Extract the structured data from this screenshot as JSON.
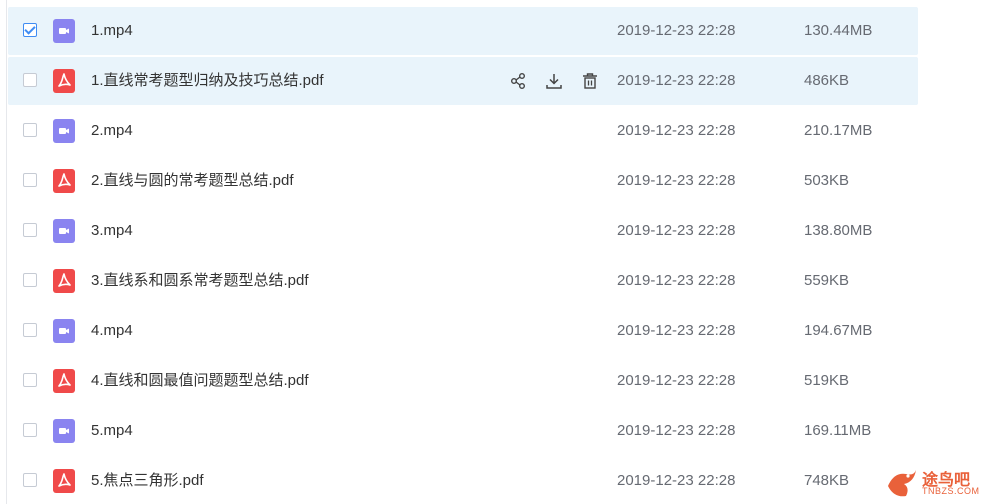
{
  "colors": {
    "video_icon": "#8a84f0",
    "pdf_icon": "#f04a4a",
    "highlight_row": "#e9f4fb",
    "checkbox_checked": "#3f8cf3",
    "watermark": "#e9613a"
  },
  "files": [
    {
      "name": "1.mp4",
      "type": "video",
      "date": "2019-12-23 22:28",
      "size": "130.44MB",
      "checked": true
    },
    {
      "name": "1.直线常考题型归纳及技巧总结.pdf",
      "type": "pdf",
      "date": "2019-12-23 22:28",
      "size": "486KB",
      "checked": false,
      "hover": true
    },
    {
      "name": "2.mp4",
      "type": "video",
      "date": "2019-12-23 22:28",
      "size": "210.17MB",
      "checked": false
    },
    {
      "name": "2.直线与圆的常考题型总结.pdf",
      "type": "pdf",
      "date": "2019-12-23 22:28",
      "size": "503KB",
      "checked": false
    },
    {
      "name": "3.mp4",
      "type": "video",
      "date": "2019-12-23 22:28",
      "size": "138.80MB",
      "checked": false
    },
    {
      "name": "3.直线系和圆系常考题型总结.pdf",
      "type": "pdf",
      "date": "2019-12-23 22:28",
      "size": "559KB",
      "checked": false
    },
    {
      "name": "4.mp4",
      "type": "video",
      "date": "2019-12-23 22:28",
      "size": "194.67MB",
      "checked": false
    },
    {
      "name": "4.直线和圆最值问题题型总结.pdf",
      "type": "pdf",
      "date": "2019-12-23 22:28",
      "size": "519KB",
      "checked": false
    },
    {
      "name": "5.mp4",
      "type": "video",
      "date": "2019-12-23 22:28",
      "size": "169.11MB",
      "checked": false
    },
    {
      "name": "5.焦点三角形.pdf",
      "type": "pdf",
      "date": "2019-12-23 22:28",
      "size": "748KB",
      "checked": false
    }
  ],
  "row_actions": [
    "share-icon",
    "download-icon",
    "delete-icon"
  ],
  "watermark": {
    "text": "途鸟吧",
    "sub": "TNBZS.COM"
  }
}
